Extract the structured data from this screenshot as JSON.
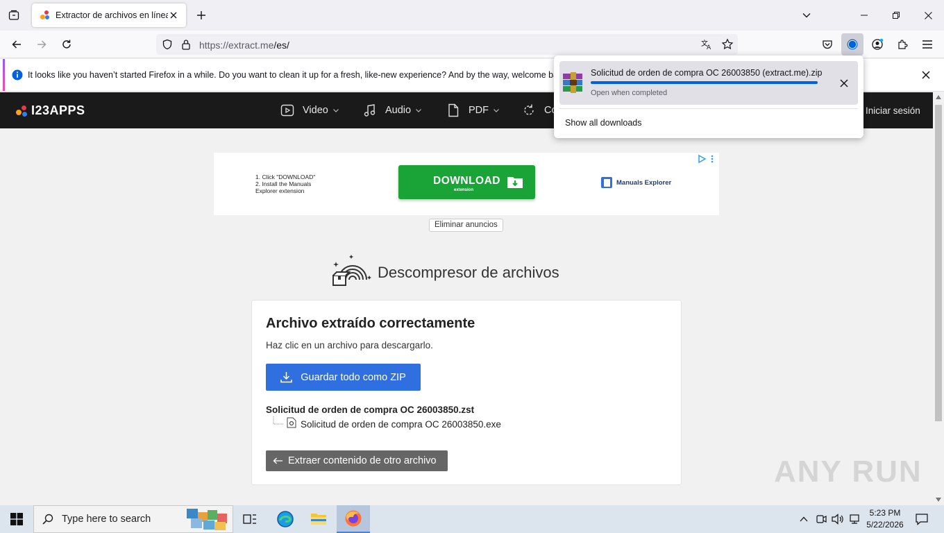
{
  "browser": {
    "tab_title": "Extractor de archivos en línea",
    "url_host": "https://extract.me",
    "url_path": "/es/"
  },
  "notification": {
    "text": "It looks like you haven’t started Firefox in a while. Do you want to clean it up for a fresh, like-new experience? And by the way, welcome back!"
  },
  "site": {
    "logo": "I23APPS",
    "menu": [
      {
        "label": "Video",
        "icon": "video-icon"
      },
      {
        "label": "Audio",
        "icon": "music-icon"
      },
      {
        "label": "PDF",
        "icon": "document-icon"
      },
      {
        "label": "Co",
        "icon": "convert-icon"
      }
    ],
    "login": "Iniciar sesión"
  },
  "ad": {
    "steps": [
      "1. Click \"DOWNLOAD\"",
      "2. Install the Manuals",
      "Explorer extension"
    ],
    "button": "DOWNLOAD",
    "button_sub": "extension",
    "brand": "Manuals Explorer",
    "remove_ads": "Eliminar anuncios"
  },
  "page": {
    "heading": "Descompresor de archivos",
    "card_title": "Archivo extraído correctamente",
    "card_subtitle": "Haz clic en un archivo para descargarlo.",
    "zip_button": "Guardar todo como ZIP",
    "archive_name": "Solicitud de orden de compra OC 26003850.zst",
    "file_name": "Solicitud de orden de compra OC 26003850.exe",
    "back_button": "Extraer contenido de otro archivo"
  },
  "downloads": {
    "file": "Solicitud de orden de compra OC 26003850 (extract.me).zip",
    "status": "Open when completed",
    "progress": 1.0,
    "show_all": "Show all downloads"
  },
  "watermark": "ANY RUN",
  "taskbar": {
    "search_placeholder": "Type here to search",
    "time": "5:23 PM",
    "date": "5/22/2026"
  },
  "colors": {
    "accent_blue": "#2f6fe0",
    "download_green": "#1aa336",
    "header_dark": "#1a1a1a",
    "firefox_blue": "#0061e0"
  }
}
